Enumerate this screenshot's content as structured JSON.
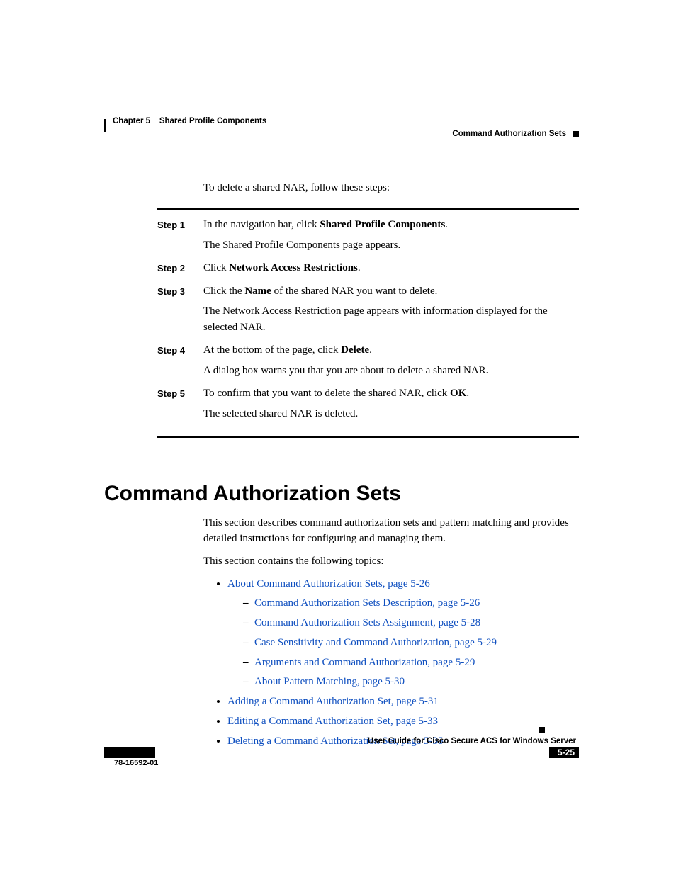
{
  "header": {
    "chapter": "Chapter 5",
    "title": "Shared Profile Components",
    "section": "Command Authorization Sets"
  },
  "intro": "To delete a shared NAR, follow these steps:",
  "steps": [
    {
      "label": "Step 1",
      "paras": [
        {
          "pre": "In the navigation bar, click ",
          "bold": "Shared Profile Components",
          "post": "."
        },
        {
          "pre": "The Shared Profile Components page appears.",
          "bold": "",
          "post": ""
        }
      ]
    },
    {
      "label": "Step 2",
      "paras": [
        {
          "pre": "Click ",
          "bold": "Network Access Restrictions",
          "post": "."
        }
      ]
    },
    {
      "label": "Step 3",
      "paras": [
        {
          "pre": "Click the ",
          "bold": "Name",
          "post": " of the shared NAR you want to delete."
        },
        {
          "pre": "The Network Access Restriction page appears with information displayed for the selected NAR.",
          "bold": "",
          "post": ""
        }
      ]
    },
    {
      "label": "Step 4",
      "paras": [
        {
          "pre": "At the bottom of the page, click ",
          "bold": "Delete",
          "post": "."
        },
        {
          "pre": "A dialog box warns you that you are about to delete a shared NAR.",
          "bold": "",
          "post": ""
        }
      ]
    },
    {
      "label": "Step 5",
      "paras": [
        {
          "pre": "To confirm that you want to delete the shared NAR, click ",
          "bold": "OK",
          "post": "."
        },
        {
          "pre": "The selected shared NAR is deleted.",
          "bold": "",
          "post": ""
        }
      ]
    }
  ],
  "heading": "Command Authorization Sets",
  "section_intro1": "This section describes command authorization sets and pattern matching and provides detailed instructions for configuring and managing them.",
  "section_intro2": "This section contains the following topics:",
  "topics": [
    {
      "label": "About Command Authorization Sets, page 5-26",
      "children": [
        "Command Authorization Sets Description, page 5-26",
        "Command Authorization Sets Assignment, page 5-28",
        "Case Sensitivity and Command Authorization, page 5-29",
        "Arguments and Command Authorization, page 5-29",
        "About Pattern Matching, page 5-30"
      ]
    },
    {
      "label": "Adding a Command Authorization Set, page 5-31",
      "children": []
    },
    {
      "label": "Editing a Command Authorization Set, page 5-33",
      "children": []
    },
    {
      "label": "Deleting a Command Authorization Set, page 5-35",
      "children": []
    }
  ],
  "footer": {
    "guide": "User Guide for Cisco Secure ACS for Windows Server",
    "docnum": "78-16592-01",
    "pagenum": "5-25"
  }
}
